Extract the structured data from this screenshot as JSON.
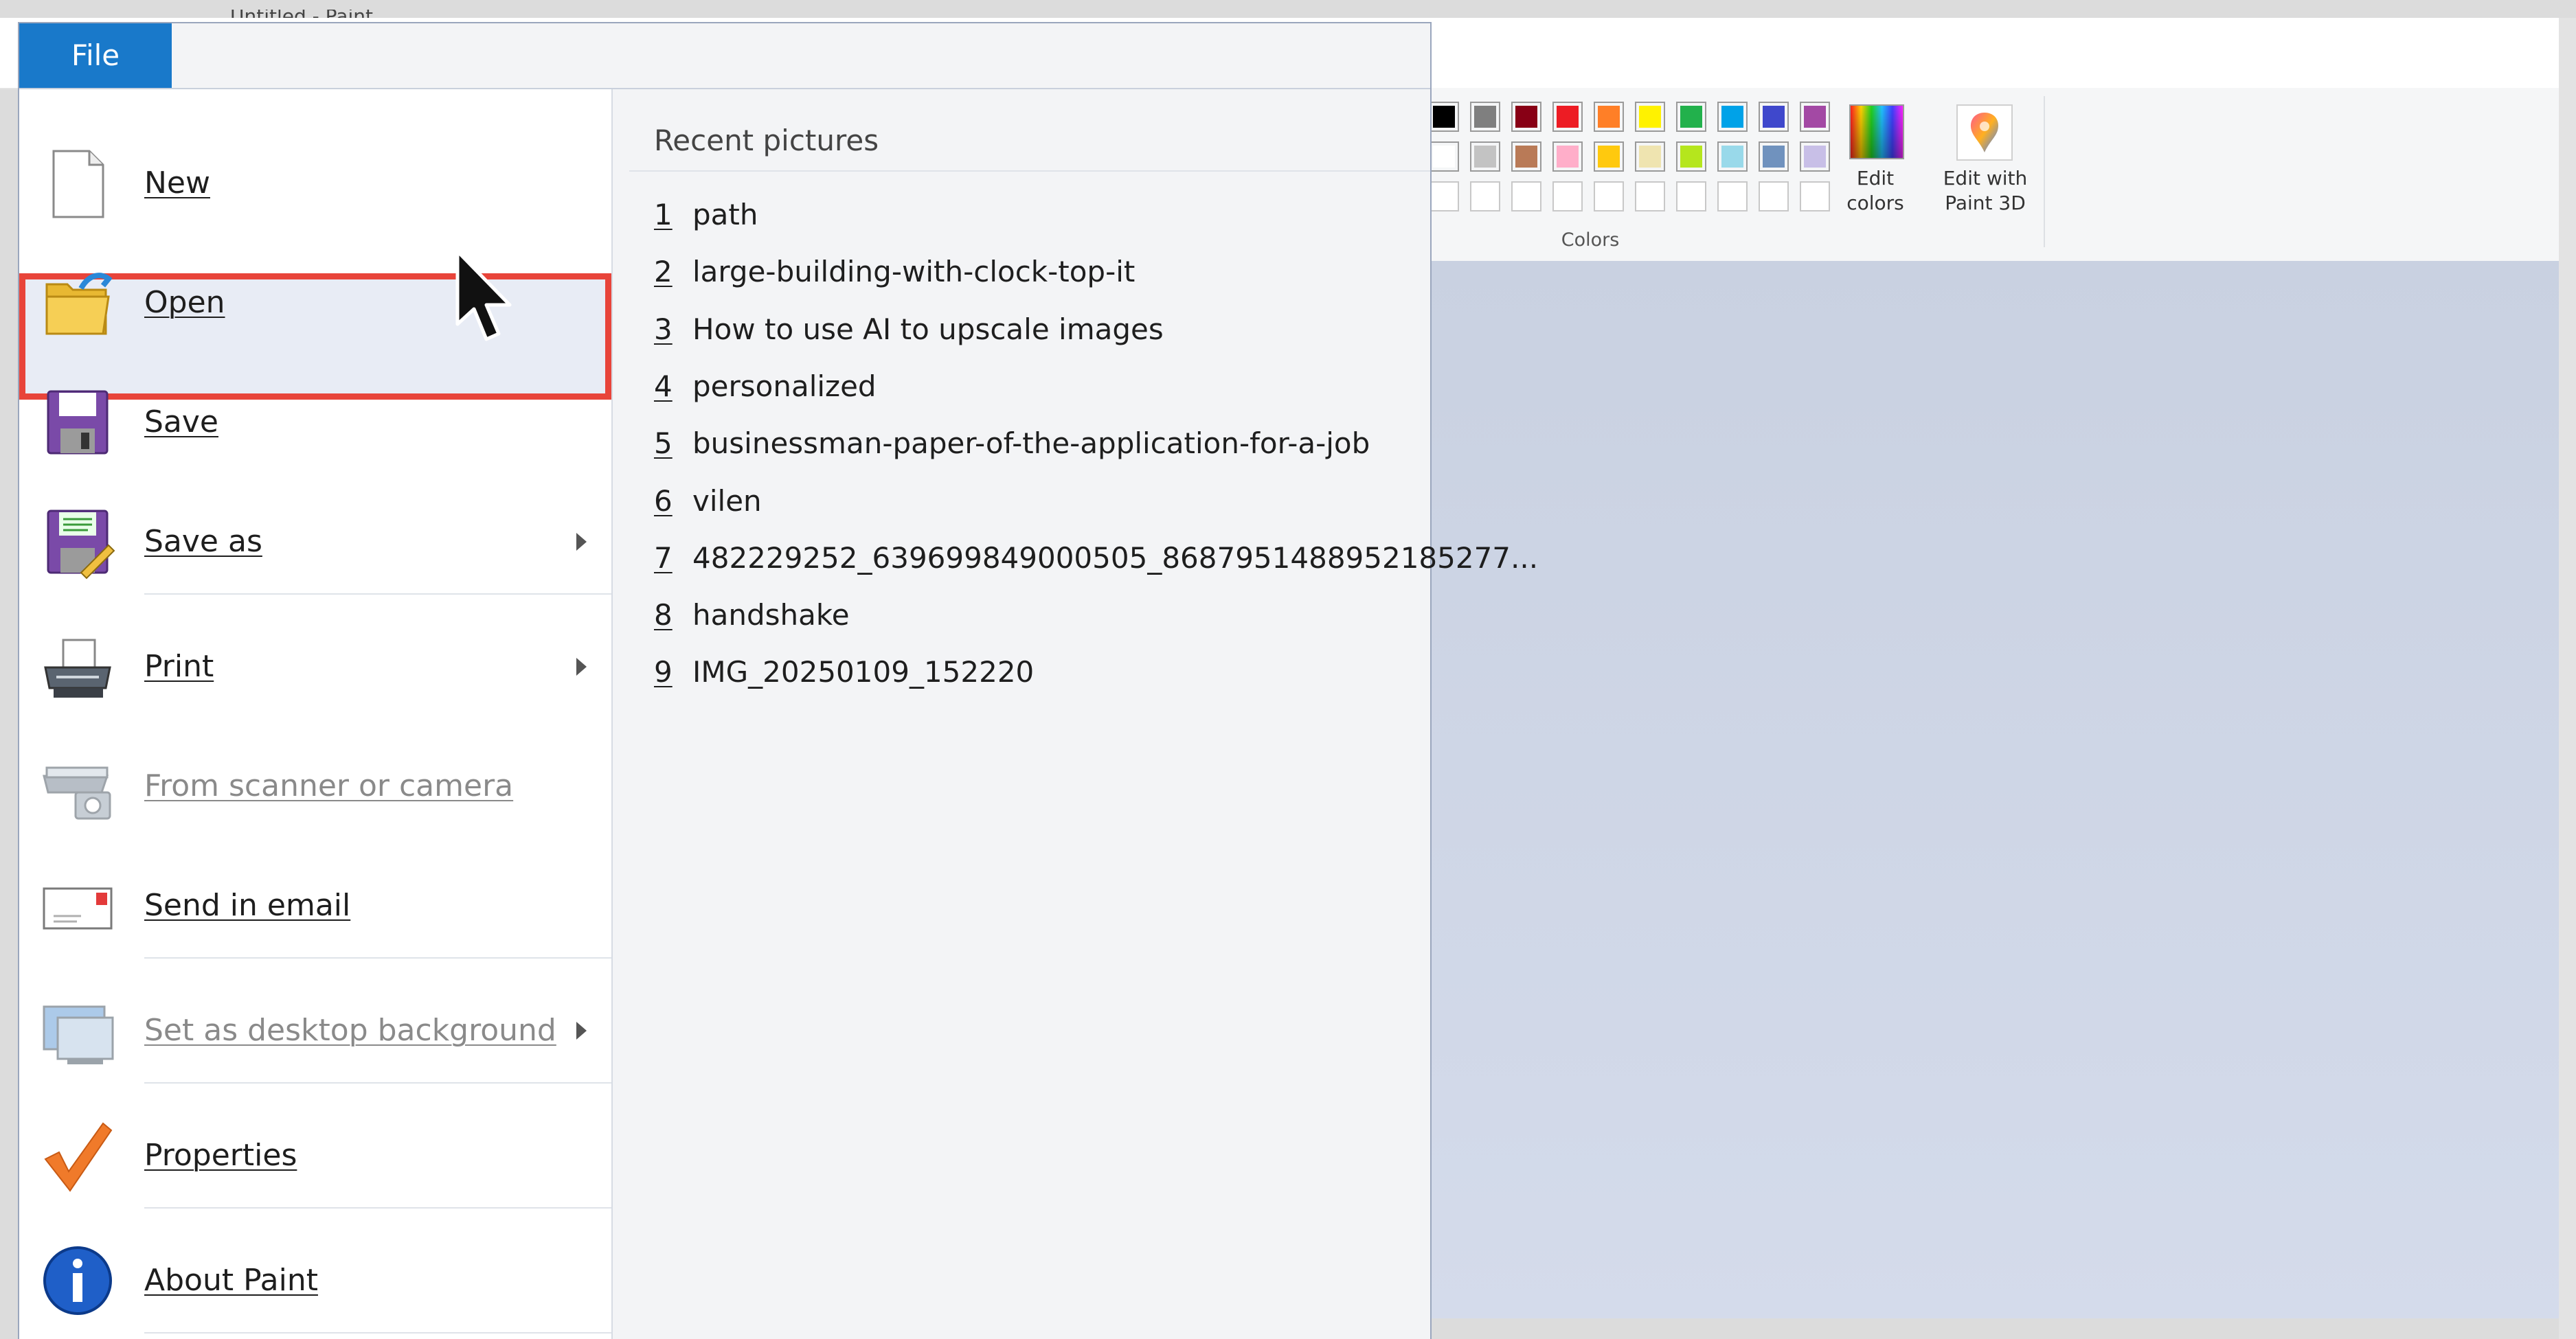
{
  "window": {
    "title": "Untitled - Paint"
  },
  "file_menu": {
    "tab_label": "File",
    "items": [
      {
        "label": "New",
        "icon": "new-document-icon",
        "enabled": true
      },
      {
        "label": "Open",
        "icon": "open-folder-icon",
        "enabled": true,
        "highlighted": true
      },
      {
        "label": "Save",
        "icon": "floppy-disk-icon",
        "enabled": true
      },
      {
        "label": "Save as",
        "icon": "save-as-icon",
        "enabled": true,
        "submenu": true
      },
      {
        "label": "Print",
        "icon": "printer-icon",
        "enabled": true,
        "submenu": true
      },
      {
        "label": "From scanner or camera",
        "icon": "scanner-camera-icon",
        "enabled": false
      },
      {
        "label": "Send in email",
        "icon": "email-icon",
        "enabled": true
      },
      {
        "label": "Set as desktop background",
        "icon": "desktop-background-icon",
        "enabled": false,
        "submenu": true
      },
      {
        "label": "Properties",
        "icon": "checkmark-icon",
        "enabled": true
      },
      {
        "label": "About Paint",
        "icon": "info-icon",
        "enabled": true
      }
    ]
  },
  "recent": {
    "heading": "Recent pictures",
    "items": [
      {
        "num": "1",
        "name": "path"
      },
      {
        "num": "2",
        "name": "large-building-with-clock-top-it"
      },
      {
        "num": "3",
        "name": "How to use AI to upscale images"
      },
      {
        "num": "4",
        "name": "personalized"
      },
      {
        "num": "5",
        "name": "businessman-paper-of-the-application-for-a-job"
      },
      {
        "num": "6",
        "name": "vilen"
      },
      {
        "num": "7",
        "name": "482229252_639699849000505_8687951488952185277..."
      },
      {
        "num": "8",
        "name": "handshake"
      },
      {
        "num": "9",
        "name": "IMG_20250109_152220"
      }
    ]
  },
  "ribbon": {
    "colors_group_label": "Colors",
    "edit_colors_label": "Edit colors",
    "edit_paint3d_label": "Edit with Paint 3D",
    "palette_row1": [
      "#000000",
      "#7f7f7f",
      "#880015",
      "#ed1c24",
      "#ff7f27",
      "#fff200",
      "#22b14c",
      "#00a2e8",
      "#3f48cc",
      "#a349a4"
    ],
    "palette_row2": [
      "#ffffff",
      "#c3c3c3",
      "#b97a57",
      "#ffaec9",
      "#ffc90e",
      "#efe4b0",
      "#b5e61d",
      "#99d9ea",
      "#7092be",
      "#c8bfe7"
    ]
  },
  "colors": {
    "accent_blue": "#1979ca",
    "highlight_border": "#e8443a",
    "canvas_bg": "#c9d1e1"
  }
}
